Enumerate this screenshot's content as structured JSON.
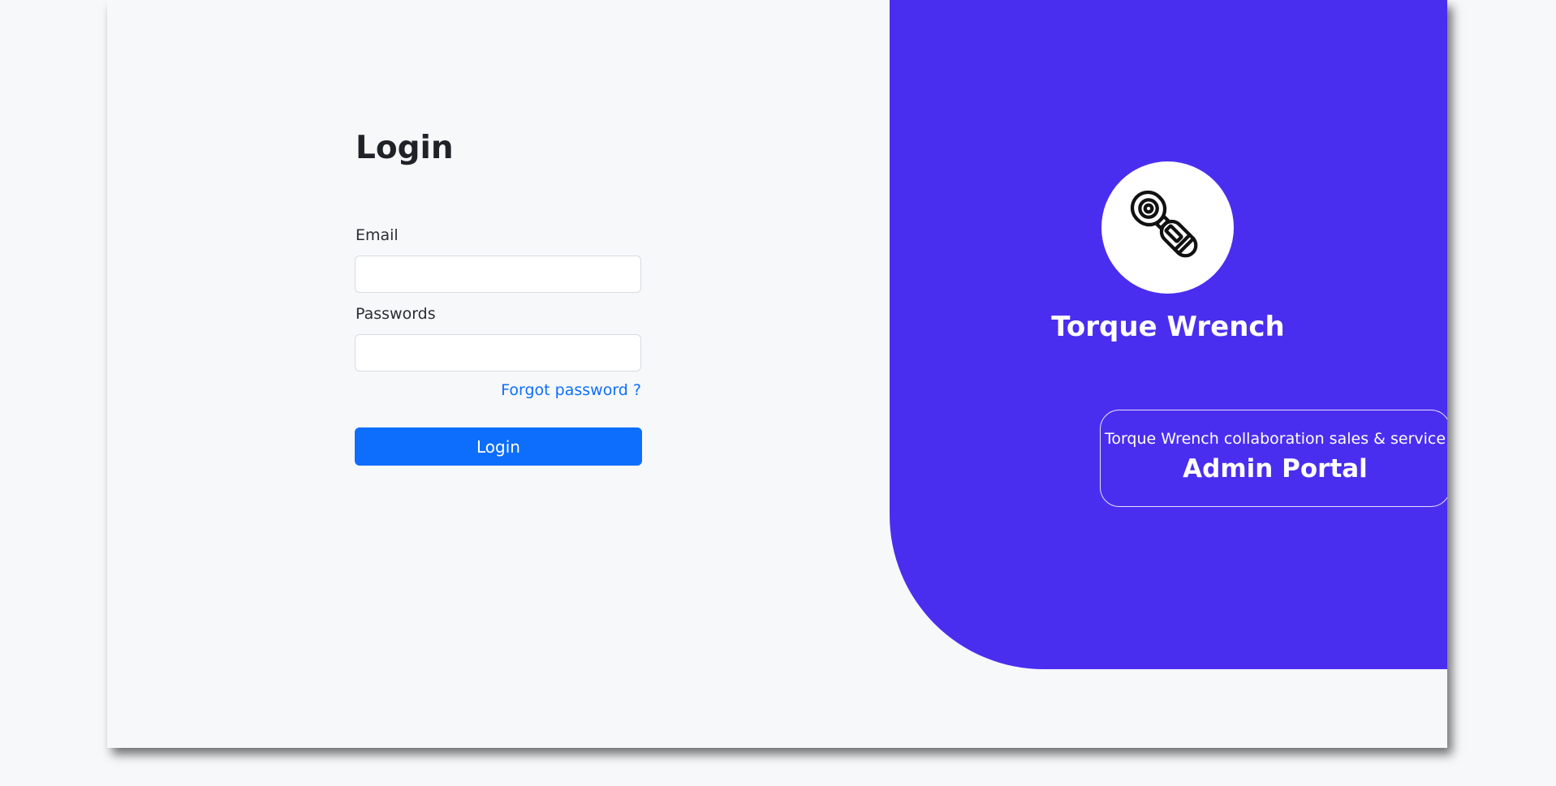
{
  "login": {
    "title": "Login",
    "email_label": "Email",
    "email_value": "",
    "password_label": "Passwords",
    "password_value": "",
    "forgot_link": "Forgot password ?",
    "submit_label": "Login"
  },
  "brand": {
    "logo_icon": "torque-wrench-icon",
    "name": "Torque Wrench",
    "tagline": "Torque Wrench collaboration sales & service",
    "portal_title": "Admin Portal"
  },
  "colors": {
    "brand_panel": "#4a2ef0",
    "primary_button": "#0d6efd",
    "link": "#0d6efd",
    "page_background": "#f7f8fa"
  }
}
